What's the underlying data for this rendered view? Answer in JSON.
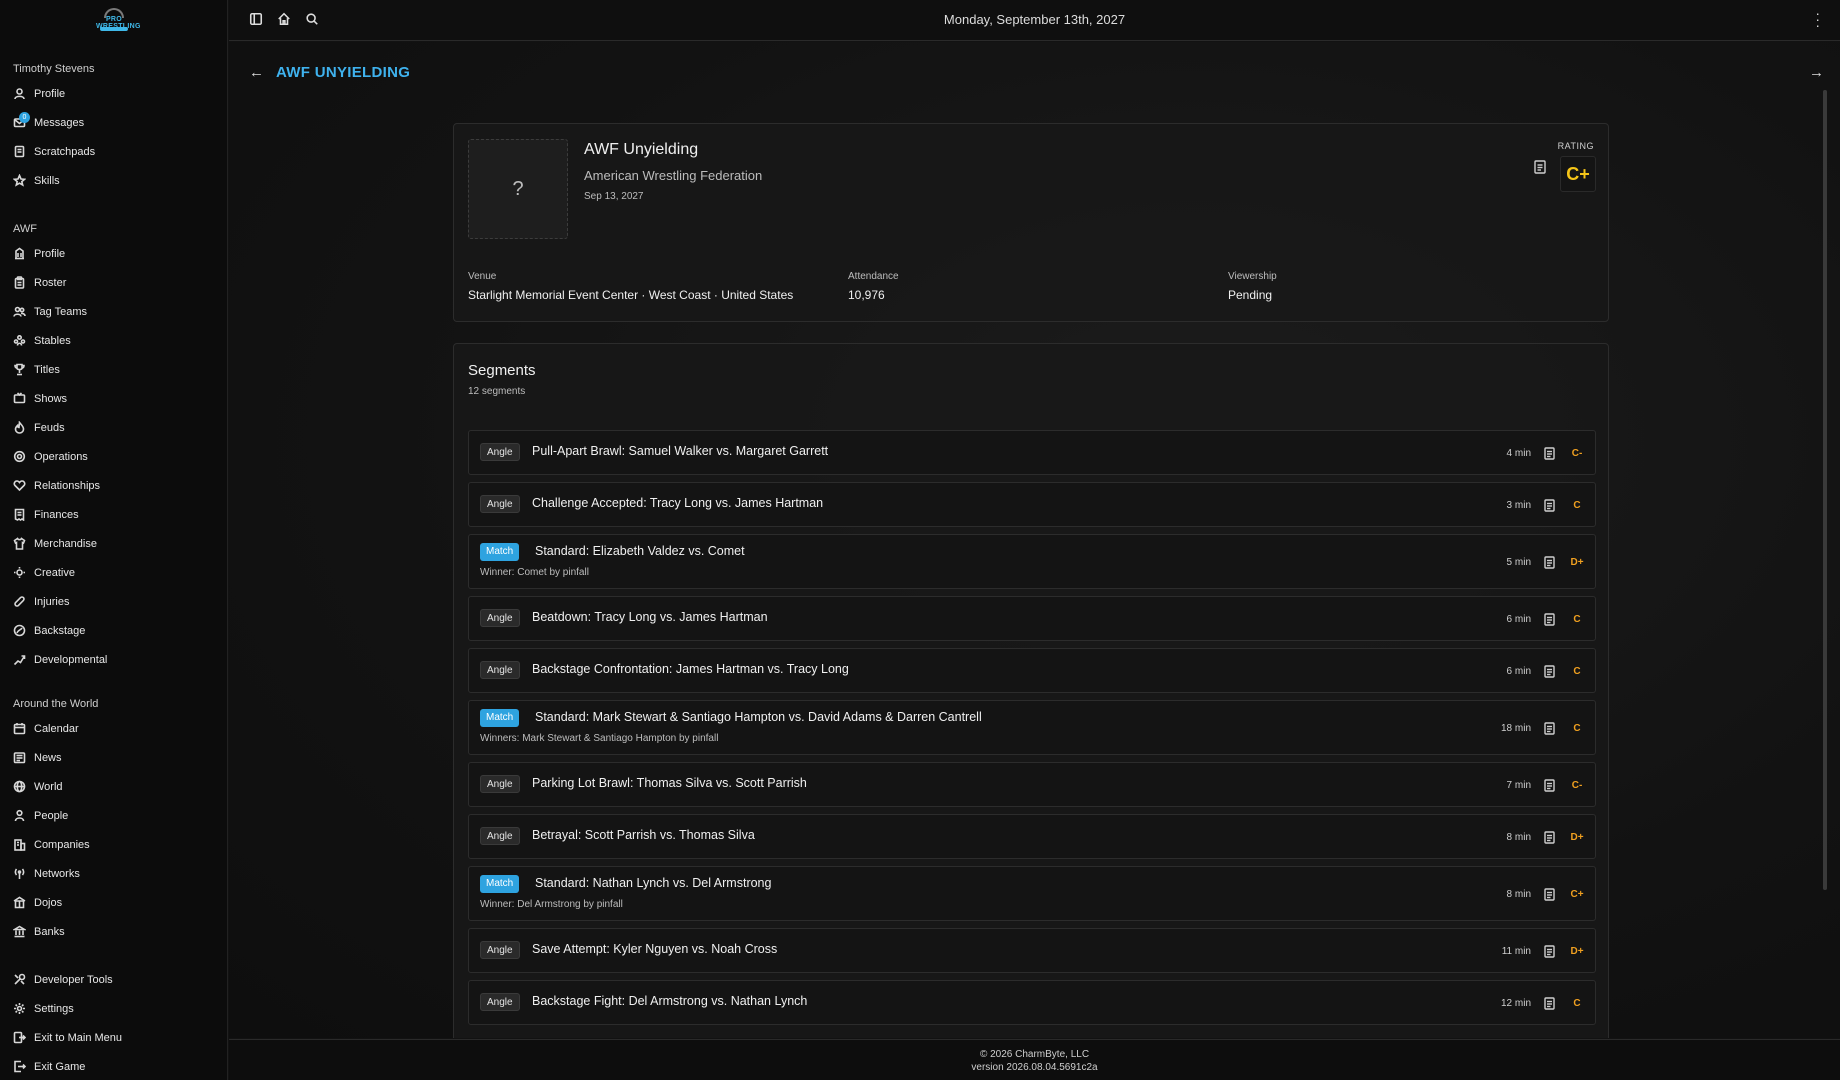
{
  "app": {
    "accent": "#3fb2ee",
    "grade_color": "#f0a020",
    "rating_color": "#f5c518"
  },
  "topbar": {
    "date": "Monday, September 13th, 2027"
  },
  "sidebar": {
    "user_group": {
      "title": "Timothy Stevens",
      "items": [
        {
          "label": "Profile",
          "icon": "user-icon"
        },
        {
          "label": "Messages",
          "icon": "mail-icon",
          "badge": "0"
        },
        {
          "label": "Scratchpads",
          "icon": "notepad-icon"
        },
        {
          "label": "Skills",
          "icon": "star-icon"
        }
      ]
    },
    "company_group": {
      "title": "AWF",
      "items": [
        {
          "label": "Profile",
          "icon": "building-icon"
        },
        {
          "label": "Roster",
          "icon": "clipboard-icon"
        },
        {
          "label": "Tag Teams",
          "icon": "users-icon"
        },
        {
          "label": "Stables",
          "icon": "group-icon"
        },
        {
          "label": "Titles",
          "icon": "trophy-icon"
        },
        {
          "label": "Shows",
          "icon": "tv-icon"
        },
        {
          "label": "Feuds",
          "icon": "flame-icon"
        },
        {
          "label": "Operations",
          "icon": "cog-icon"
        },
        {
          "label": "Relationships",
          "icon": "heart-icon"
        },
        {
          "label": "Finances",
          "icon": "receipt-icon"
        },
        {
          "label": "Merchandise",
          "icon": "shirt-icon"
        },
        {
          "label": "Creative",
          "icon": "bulb-icon"
        },
        {
          "label": "Injuries",
          "icon": "bandage-icon"
        },
        {
          "label": "Backstage",
          "icon": "door-icon"
        },
        {
          "label": "Developmental",
          "icon": "growth-icon"
        }
      ]
    },
    "world_group": {
      "title": "Around the World",
      "items": [
        {
          "label": "Calendar",
          "icon": "calendar-icon"
        },
        {
          "label": "News",
          "icon": "newspaper-icon"
        },
        {
          "label": "World",
          "icon": "globe-icon"
        },
        {
          "label": "People",
          "icon": "person-icon"
        },
        {
          "label": "Companies",
          "icon": "office-icon"
        },
        {
          "label": "Networks",
          "icon": "antenna-icon"
        },
        {
          "label": "Dojos",
          "icon": "dojo-icon"
        },
        {
          "label": "Banks",
          "icon": "bank-icon"
        }
      ]
    },
    "system_group": {
      "items": [
        {
          "label": "Developer Tools",
          "icon": "tools-icon"
        },
        {
          "label": "Settings",
          "icon": "settings-icon"
        },
        {
          "label": "Exit to Main Menu",
          "icon": "exit-menu-icon"
        },
        {
          "label": "Exit Game",
          "icon": "exit-icon"
        }
      ]
    }
  },
  "page": {
    "title": "AWF UNYIELDING"
  },
  "show": {
    "placeholder": "?",
    "name": "AWF Unyielding",
    "company": "American Wrestling Federation",
    "date": "Sep 13, 2027",
    "rating_label": "RATING",
    "rating": "C+",
    "venue_label": "Venue",
    "venue": "Starlight Memorial Event Center · West Coast · United States",
    "attendance_label": "Attendance",
    "attendance": "10,976",
    "viewership_label": "Viewership",
    "viewership": "Pending"
  },
  "segments": {
    "title": "Segments",
    "count": "12 segments",
    "items": [
      {
        "type": "Angle",
        "title": "Pull-Apart Brawl: Samuel Walker vs. Margaret Garrett",
        "duration": "4 min",
        "grade": "C-"
      },
      {
        "type": "Angle",
        "title": "Challenge Accepted: Tracy Long vs. James Hartman",
        "duration": "3 min",
        "grade": "C"
      },
      {
        "type": "Match",
        "title": "Standard: Elizabeth Valdez vs. Comet",
        "result": "Winner: Comet by pinfall",
        "duration": "5 min",
        "grade": "D+"
      },
      {
        "type": "Angle",
        "title": "Beatdown: Tracy Long vs. James Hartman",
        "duration": "6 min",
        "grade": "C"
      },
      {
        "type": "Angle",
        "title": "Backstage Confrontation: James Hartman vs. Tracy Long",
        "duration": "6 min",
        "grade": "C"
      },
      {
        "type": "Match",
        "title": "Standard: Mark Stewart & Santiago Hampton vs. David Adams & Darren Cantrell",
        "result": "Winners: Mark Stewart & Santiago Hampton by pinfall",
        "duration": "18 min",
        "grade": "C"
      },
      {
        "type": "Angle",
        "title": "Parking Lot Brawl: Thomas Silva vs. Scott Parrish",
        "duration": "7 min",
        "grade": "C-"
      },
      {
        "type": "Angle",
        "title": "Betrayal: Scott Parrish vs. Thomas Silva",
        "duration": "8 min",
        "grade": "D+"
      },
      {
        "type": "Match",
        "title": "Standard: Nathan Lynch vs. Del Armstrong",
        "result": "Winner: Del Armstrong by pinfall",
        "duration": "8 min",
        "grade": "C+"
      },
      {
        "type": "Angle",
        "title": "Save Attempt: Kyler Nguyen vs. Noah Cross",
        "duration": "11 min",
        "grade": "D+"
      },
      {
        "type": "Angle",
        "title": "Backstage Fight: Del Armstrong vs. Nathan Lynch",
        "duration": "12 min",
        "grade": "C"
      }
    ]
  },
  "footer": {
    "copyright": "© 2026 CharmByte, LLC",
    "version": "version 2026.08.04.5691c2a"
  }
}
